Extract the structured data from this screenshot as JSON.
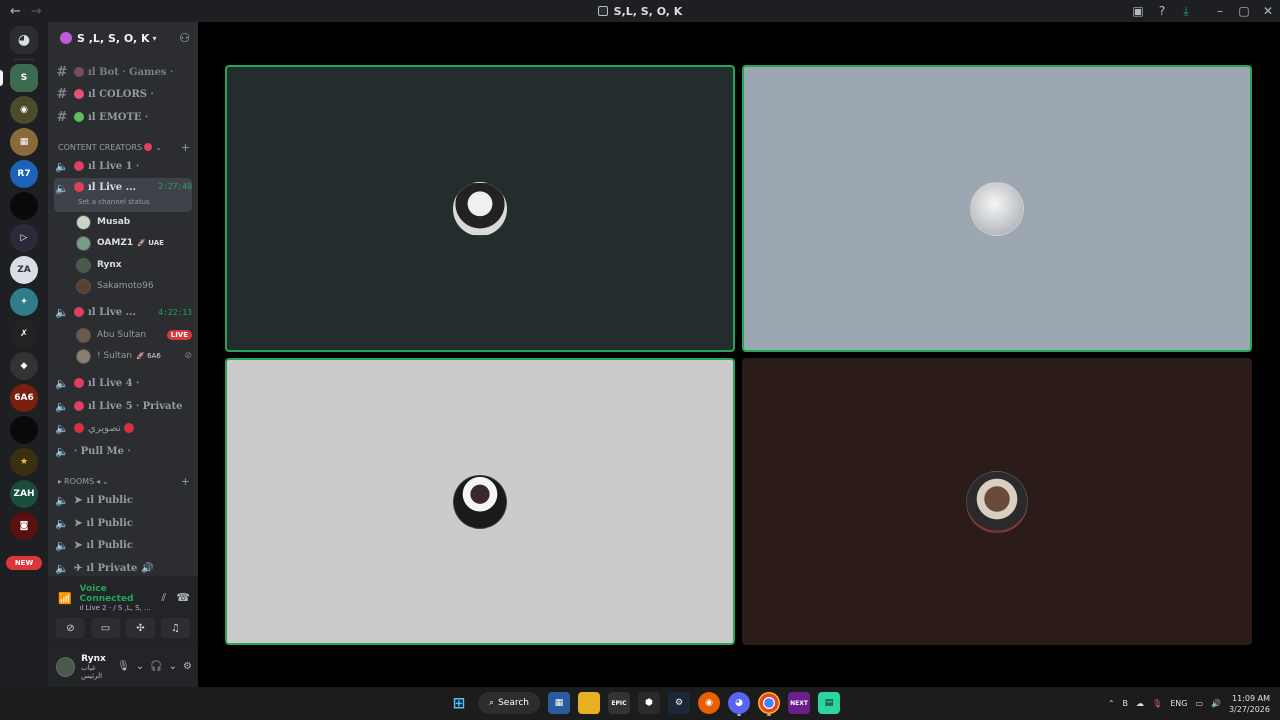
{
  "window": {
    "title": "S,L, S, O, K"
  },
  "guild": {
    "name": "S ,L, S, O, K"
  },
  "channels_top": [
    {
      "name": "ıl Bot ‧ Games ‧",
      "color": "#7a4b5a"
    },
    {
      "name": "ıl COLORS ‧",
      "color": "#e94f77"
    },
    {
      "name": "ıl EMOTE ‧",
      "color": "#5fbf5a"
    }
  ],
  "category_creators": "CONTENT CREATORS",
  "voice_channels": [
    {
      "name": "ıl Live 1 ‧"
    },
    {
      "name": "ıl Live ...",
      "timer": "2:27:40",
      "status_hint": "Set a channel status"
    },
    {
      "name": "ıl Live ...",
      "timer": "4:22:13"
    },
    {
      "name": "ıl Live 4 ‧"
    },
    {
      "name": "ıl Live 5 ‧ Private"
    },
    {
      "name": "تصويري"
    },
    {
      "name": "‧ Pull Me ‧"
    }
  ],
  "members_live2": [
    {
      "name": "Musab",
      "tag": ""
    },
    {
      "name": "OAMZ1",
      "tag": "🚀 UAE"
    },
    {
      "name": "Rynx",
      "tag": ""
    },
    {
      "name": "Sakamoto96",
      "tag": ""
    }
  ],
  "members_live3": [
    {
      "name": "Abu Sultan",
      "badge": "LIVE"
    },
    {
      "name": "! Sultan",
      "tag": "🚀 6A6"
    }
  ],
  "category_rooms": "ROOMS",
  "rooms": [
    {
      "name": "ıl Public"
    },
    {
      "name": "ıl Public"
    },
    {
      "name": "ıl Public"
    },
    {
      "name": "ıl Private"
    }
  ],
  "voice_panel": {
    "title": "Voice Connected",
    "sub": "ıl Live 2 ‧ / S ,L, S, ..."
  },
  "user": {
    "name": "Rynx",
    "status": "غياب الرئيس"
  },
  "rail_badge": "NEW",
  "taskbar": {
    "search_label": "Search",
    "lang": "ENG",
    "time": "11:09 AM",
    "date": "3/27/2026"
  },
  "tiles": [
    {
      "bg": "#252c2e",
      "speaking": true,
      "avatar_color": "#d9d9d9"
    },
    {
      "bg": "#9da7b1",
      "speaking": true,
      "avatar_color": "#e8e8e8"
    },
    {
      "bg": "#cbcbcb",
      "speaking": true,
      "avatar_color": "#3a2a2a"
    },
    {
      "bg": "#2b1c19",
      "speaking": false,
      "avatar_color": "#6b4a3a"
    }
  ],
  "colors": {
    "accent_green": "#23a55a",
    "live_red": "#da373c",
    "sidebar": "#2b2d31",
    "rail": "#1e1f22"
  },
  "icons": {
    "discord-home": "discord-icon",
    "hash": "hash-icon",
    "speaker": "speaker-icon"
  }
}
